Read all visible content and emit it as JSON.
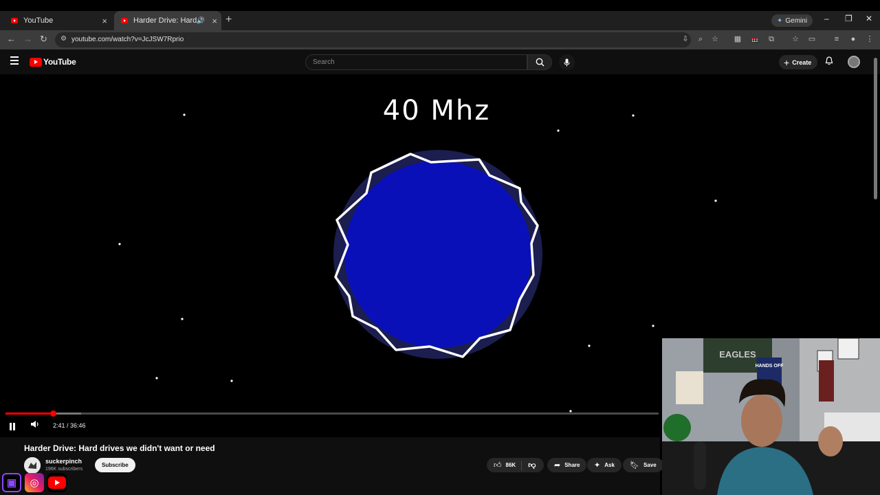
{
  "browser": {
    "tabs": [
      {
        "label": "YouTube"
      },
      {
        "label": "Harder Drive: Hard drives w"
      }
    ],
    "gemini_label": "Gemini",
    "url": "youtube.com/watch?v=JcJSW7Rprio",
    "extension_badge": "112"
  },
  "yt": {
    "logo_text": "YouTube",
    "search_placeholder": "Search",
    "create_label": "Create"
  },
  "video": {
    "frame_text": "40 Mhz",
    "time": "2:41 / 36:46",
    "progress_fraction": 0.073
  },
  "meta": {
    "title": "Harder Drive: Hard drives we didn't want or need",
    "channel": "suckerpinch",
    "subscribers": "196K subscribers",
    "subscribe_label": "Subscribe",
    "likes": "86K",
    "share_label": "Share",
    "ask_label": "Ask",
    "save_label": "Save"
  },
  "webcam": {
    "sign_eagles": "EAGLES",
    "sign_hands_off": "HANDS OFF"
  },
  "colors": {
    "youtube_red": "#ff0000",
    "planet_blue": "#0a10b8",
    "planet_halo": "#1b1e4e"
  }
}
